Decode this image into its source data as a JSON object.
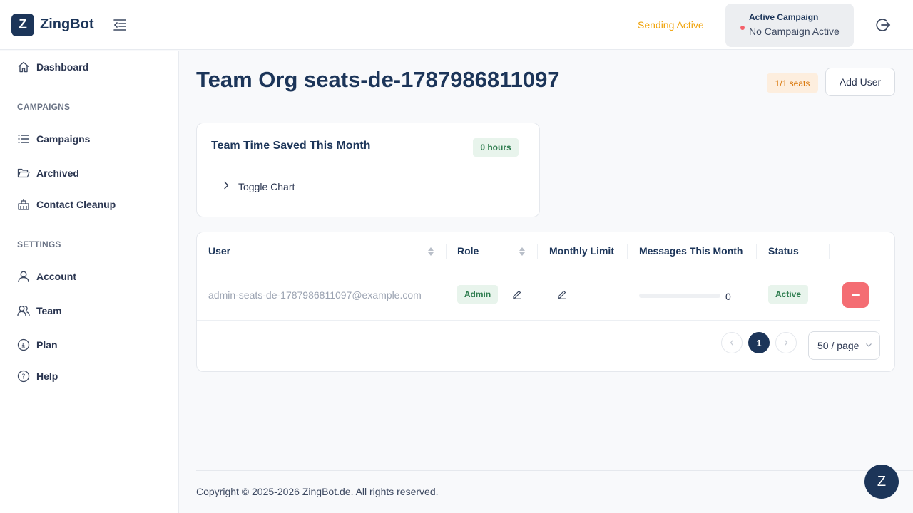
{
  "colors": {
    "brand": "#1c3559",
    "warning": "#f0a30a",
    "success_bg": "#e8f4ec",
    "success_text": "#2e7d4f",
    "danger": "#f46d73"
  },
  "header": {
    "logo_letter": "Z",
    "brand": "ZingBot",
    "sending_status": "Sending Active",
    "campaign_title": "Active Campaign",
    "campaign_value": "No Campaign Active"
  },
  "sidebar": {
    "dashboard": "Dashboard",
    "campaigns_section": "CAMPAIGNS",
    "campaigns": "Campaigns",
    "archived": "Archived",
    "contact_cleanup": "Contact Cleanup",
    "settings_section": "SETTINGS",
    "account": "Account",
    "team": "Team",
    "plan": "Plan",
    "help": "Help"
  },
  "main": {
    "title": "Team Org seats-de-1787986811097",
    "seats_badge": "1/1 seats",
    "add_user": "Add User",
    "time_card": {
      "title": "Team Time Saved This Month",
      "hours_badge": "0 hours",
      "toggle_label": "Toggle Chart"
    },
    "table": {
      "columns": {
        "user": "User",
        "role": "Role",
        "monthly_limit": "Monthly Limit",
        "messages": "Messages This Month",
        "status": "Status"
      },
      "rows": [
        {
          "email": "admin-seats-de-1787986811097@example.com",
          "role": "Admin",
          "messages_count": "0",
          "messages_progress": 0,
          "status": "Active"
        }
      ]
    },
    "pagination": {
      "current_page": "1",
      "page_size": "50 / page"
    }
  },
  "footer": {
    "copyright": "Copyright © 2025-2026 ZingBot.de. All rights reserved."
  },
  "chat_widget_letter": "Z"
}
